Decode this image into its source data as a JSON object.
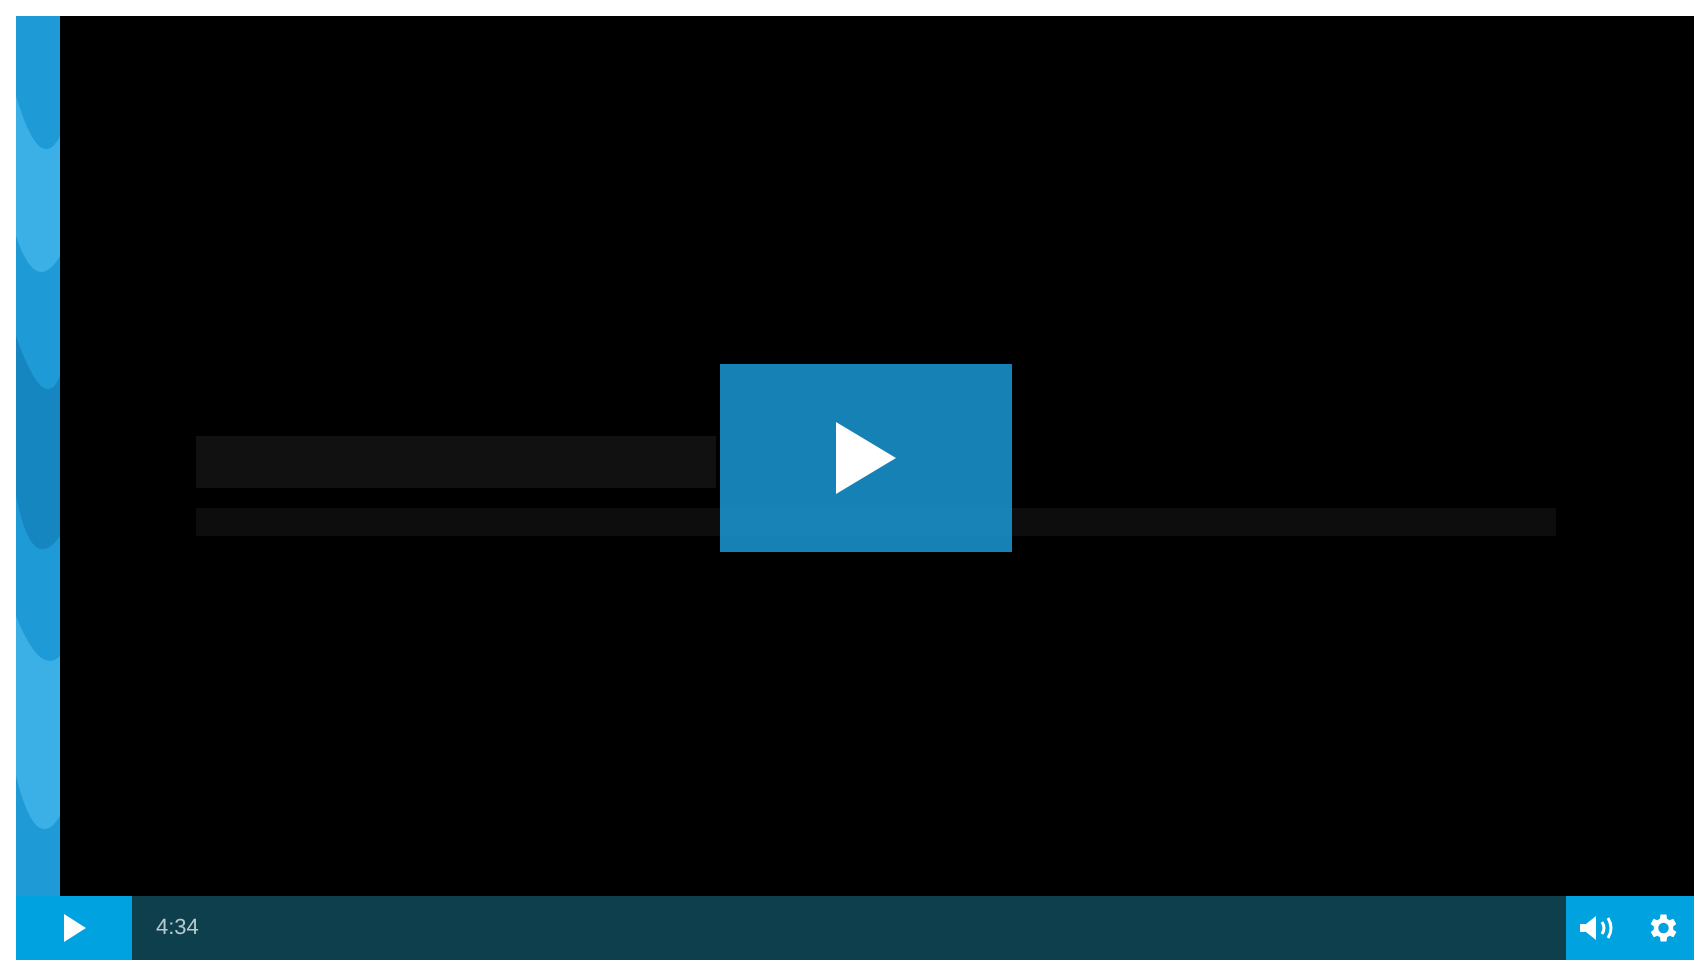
{
  "controls": {
    "time": "4:34"
  }
}
